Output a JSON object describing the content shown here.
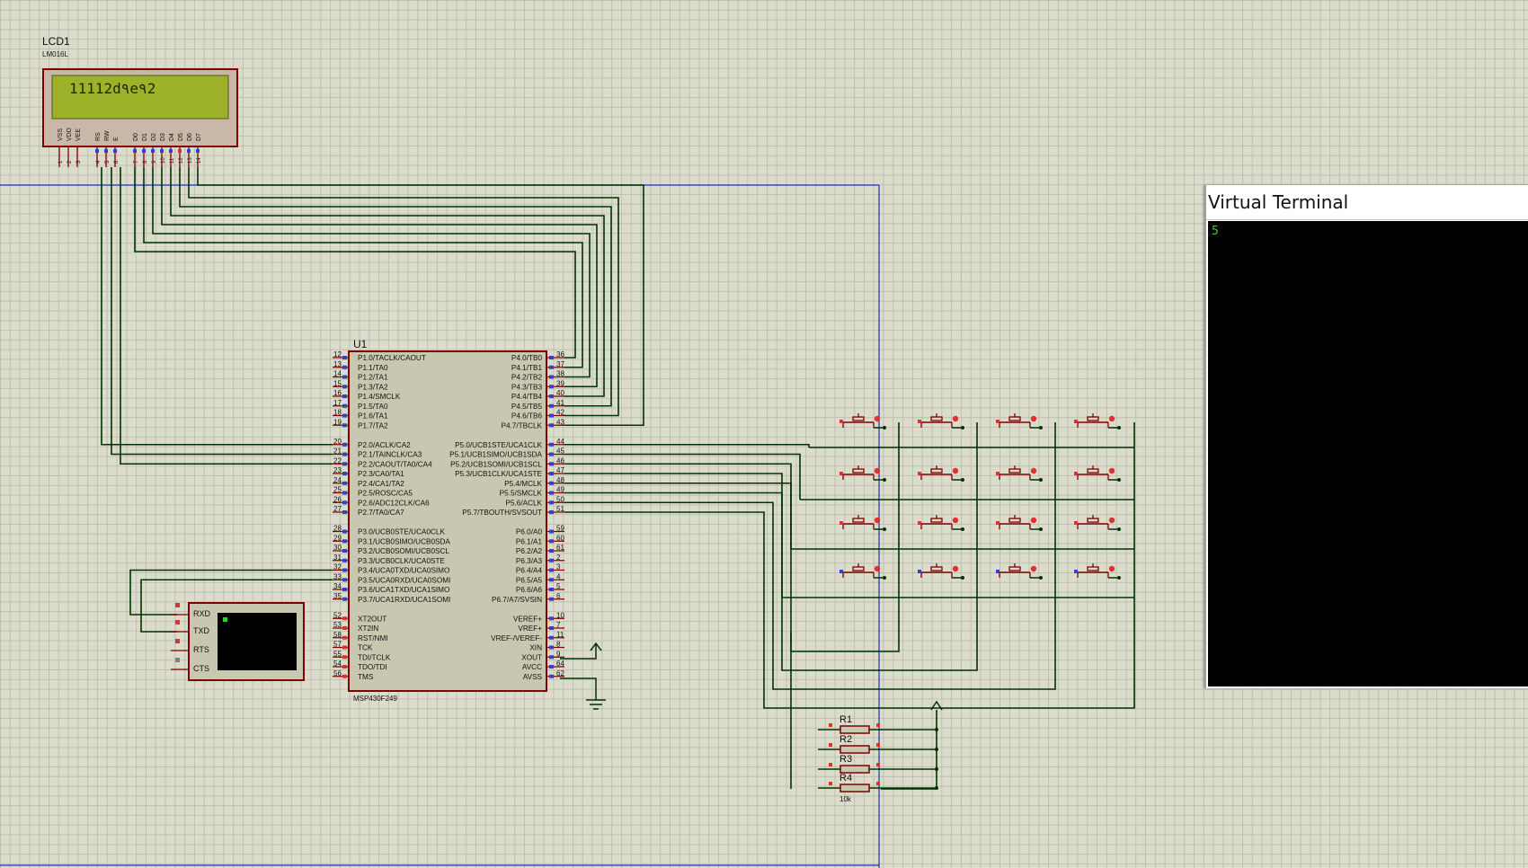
{
  "lcd": {
    "ref": "LCD1",
    "model": "LM016L",
    "display_text": "11112d٩e٩2",
    "pin_labels": [
      "VSS",
      "VDD",
      "VEE",
      "RS",
      "RW",
      "E",
      "D0",
      "D1",
      "D2",
      "D3",
      "D4",
      "D5",
      "D6",
      "D7"
    ],
    "pin_numbers": [
      "1",
      "2",
      "3",
      "4",
      "5",
      "6",
      "7",
      "8",
      "9",
      "10",
      "11",
      "12",
      "13",
      "14"
    ]
  },
  "mcu": {
    "ref": "U1",
    "model": "MSP430F249",
    "left_pins": [
      {
        "num": "12",
        "name": "P1.0/TACLK/CAOUT"
      },
      {
        "num": "13",
        "name": "P1.1/TA0"
      },
      {
        "num": "14",
        "name": "P1.2/TA1"
      },
      {
        "num": "15",
        "name": "P1.3/TA2"
      },
      {
        "num": "16",
        "name": "P1.4/SMCLK"
      },
      {
        "num": "17",
        "name": "P1.5/TA0"
      },
      {
        "num": "18",
        "name": "P1.6/TA1"
      },
      {
        "num": "19",
        "name": "P1.7/TA2"
      },
      {
        "num": "",
        "name": ""
      },
      {
        "num": "20",
        "name": "P2.0/ACLK/CA2"
      },
      {
        "num": "21",
        "name": "P2.1/TAINCLK/CA3"
      },
      {
        "num": "22",
        "name": "P2.2/CAOUT/TA0/CA4"
      },
      {
        "num": "23",
        "name": "P2.3/CA0/TA1"
      },
      {
        "num": "24",
        "name": "P2.4/CA1/TA2"
      },
      {
        "num": "25",
        "name": "P2.5/ROSC/CA5"
      },
      {
        "num": "26",
        "name": "P2.6/ADC12CLK/CA6"
      },
      {
        "num": "27",
        "name": "P2.7/TA0/CA7"
      },
      {
        "num": "",
        "name": ""
      },
      {
        "num": "28",
        "name": "P3.0/UCB0STE/UCA0CLK"
      },
      {
        "num": "29",
        "name": "P3.1/UCB0SIMO/UCB0SDA"
      },
      {
        "num": "30",
        "name": "P3.2/UCB0SOMI/UCB0SCL"
      },
      {
        "num": "31",
        "name": "P3.3/UCB0CLK/UCA0STE"
      },
      {
        "num": "32",
        "name": "P3.4/UCA0TXD/UCA0SIMO"
      },
      {
        "num": "33",
        "name": "P3.5/UCA0RXD/UCA0SOMI"
      },
      {
        "num": "34",
        "name": "P3.6/UCA1TXD/UCA1SIMO"
      },
      {
        "num": "35",
        "name": "P3.7/UCA1RXD/UCA1SOMI"
      },
      {
        "num": "",
        "name": ""
      },
      {
        "num": "52",
        "name": "XT2OUT"
      },
      {
        "num": "53",
        "name": "XT2IN"
      },
      {
        "num": "58",
        "name": "RST/NMI"
      },
      {
        "num": "57",
        "name": "TCK"
      },
      {
        "num": "55",
        "name": "TDI/TCLK"
      },
      {
        "num": "54",
        "name": "TDO/TDI"
      },
      {
        "num": "56",
        "name": "TMS"
      }
    ],
    "right_pins": [
      {
        "num": "36",
        "name": "P4.0/TB0"
      },
      {
        "num": "37",
        "name": "P4.1/TB1"
      },
      {
        "num": "38",
        "name": "P4.2/TB2"
      },
      {
        "num": "39",
        "name": "P4.3/TB3"
      },
      {
        "num": "40",
        "name": "P4.4/TB4"
      },
      {
        "num": "41",
        "name": "P4.5/TB5"
      },
      {
        "num": "42",
        "name": "P4.6/TB6"
      },
      {
        "num": "43",
        "name": "P4.7/TBCLK"
      },
      {
        "num": "",
        "name": ""
      },
      {
        "num": "44",
        "name": "P5.0/UCB1STE/UCA1CLK"
      },
      {
        "num": "45",
        "name": "P5.1/UCB1SIMO/UCB1SDA"
      },
      {
        "num": "46",
        "name": "P5.2/UCB1SOMI/UCB1SCL"
      },
      {
        "num": "47",
        "name": "P5.3/UCB1CLK/UCA1STE"
      },
      {
        "num": "48",
        "name": "P5.4/MCLK"
      },
      {
        "num": "49",
        "name": "P5.5/SMCLK"
      },
      {
        "num": "50",
        "name": "P5.6/ACLK"
      },
      {
        "num": "51",
        "name": "P5.7/TBOUTH/SVSOUT"
      },
      {
        "num": "",
        "name": ""
      },
      {
        "num": "59",
        "name": "P6.0/A0"
      },
      {
        "num": "60",
        "name": "P6.1/A1"
      },
      {
        "num": "61",
        "name": "P6.2/A2"
      },
      {
        "num": "2",
        "name": "P6.3/A3"
      },
      {
        "num": "3",
        "name": "P6.4/A4"
      },
      {
        "num": "4",
        "name": "P6.5/A5"
      },
      {
        "num": "5",
        "name": "P6.6/A6"
      },
      {
        "num": "6",
        "name": "P6.7/A7/SVSIN"
      },
      {
        "num": "",
        "name": ""
      },
      {
        "num": "10",
        "name": "VEREF+"
      },
      {
        "num": "7",
        "name": "VREF+"
      },
      {
        "num": "11",
        "name": "VREF-/VEREF-"
      },
      {
        "num": "8",
        "name": "XIN"
      },
      {
        "num": "9",
        "name": "XOUT"
      },
      {
        "num": "64",
        "name": "AVCC"
      },
      {
        "num": "62",
        "name": "AVSS"
      }
    ]
  },
  "terminal_block": {
    "pins": [
      "RXD",
      "TXD",
      "RTS",
      "CTS"
    ]
  },
  "resistors": {
    "labels": [
      "R1",
      "R2",
      "R3",
      "R4"
    ],
    "value": "10k"
  },
  "virtual_terminal": {
    "title": "Virtual Terminal",
    "output": "5"
  },
  "colors": {
    "wire": "#003300",
    "component_outline": "#800000",
    "component_body": "#c8c8b0",
    "lcd_screen": "#9db22a",
    "blue_wire": "#0000c0",
    "pin_red": "#e03030",
    "pin_blue": "#3040e0"
  }
}
